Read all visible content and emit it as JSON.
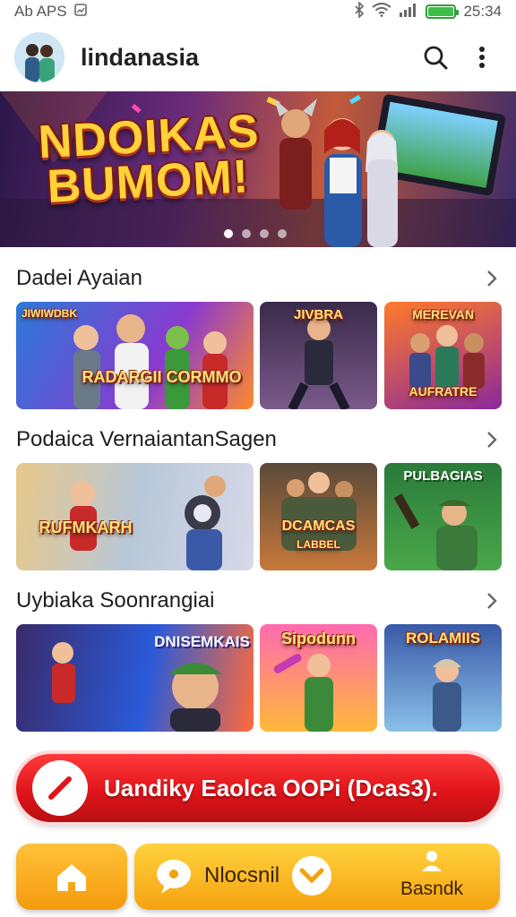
{
  "status_bar": {
    "carrier": "Ab APS",
    "time": "25:34"
  },
  "app_bar": {
    "title": "lindanasia"
  },
  "hero": {
    "title_line1": "NDOIKAS",
    "title_line2": "BUMOM!",
    "pages": 4,
    "active_page": 1
  },
  "sections": [
    {
      "title": "Dadei Ayaian",
      "tiles": [
        {
          "label": "RADARGII CORMMO",
          "tag": "JIWIWDBK"
        },
        {
          "label": "JIVBRA"
        },
        {
          "label": "AUFRATRE",
          "tag": "MEREVAN"
        }
      ]
    },
    {
      "title": "Podaica VernaiantanSagen",
      "tiles": [
        {
          "label": "RUFMKARH"
        },
        {
          "label": ""
        },
        {
          "label": "DCAMCAS",
          "tag": "LABBEL"
        },
        {
          "label": "PULBAGIAS"
        }
      ]
    },
    {
      "title": "Uybiaka Soonrangiai",
      "tiles": [
        {
          "label": "DNISEMKAIS"
        },
        {
          "label": "Sipodunn"
        },
        {
          "label": "ROLAMIIS"
        }
      ]
    }
  ],
  "promo": {
    "text": "Uandiky Eaolca OOPi (Dcas3)."
  },
  "bottom_nav": {
    "center_label": "Nlocsnil",
    "right_label": "Basndk"
  },
  "colors": {
    "promo": "#e0141a",
    "nav": "#f5a20f",
    "accent": "#ffd23a"
  }
}
